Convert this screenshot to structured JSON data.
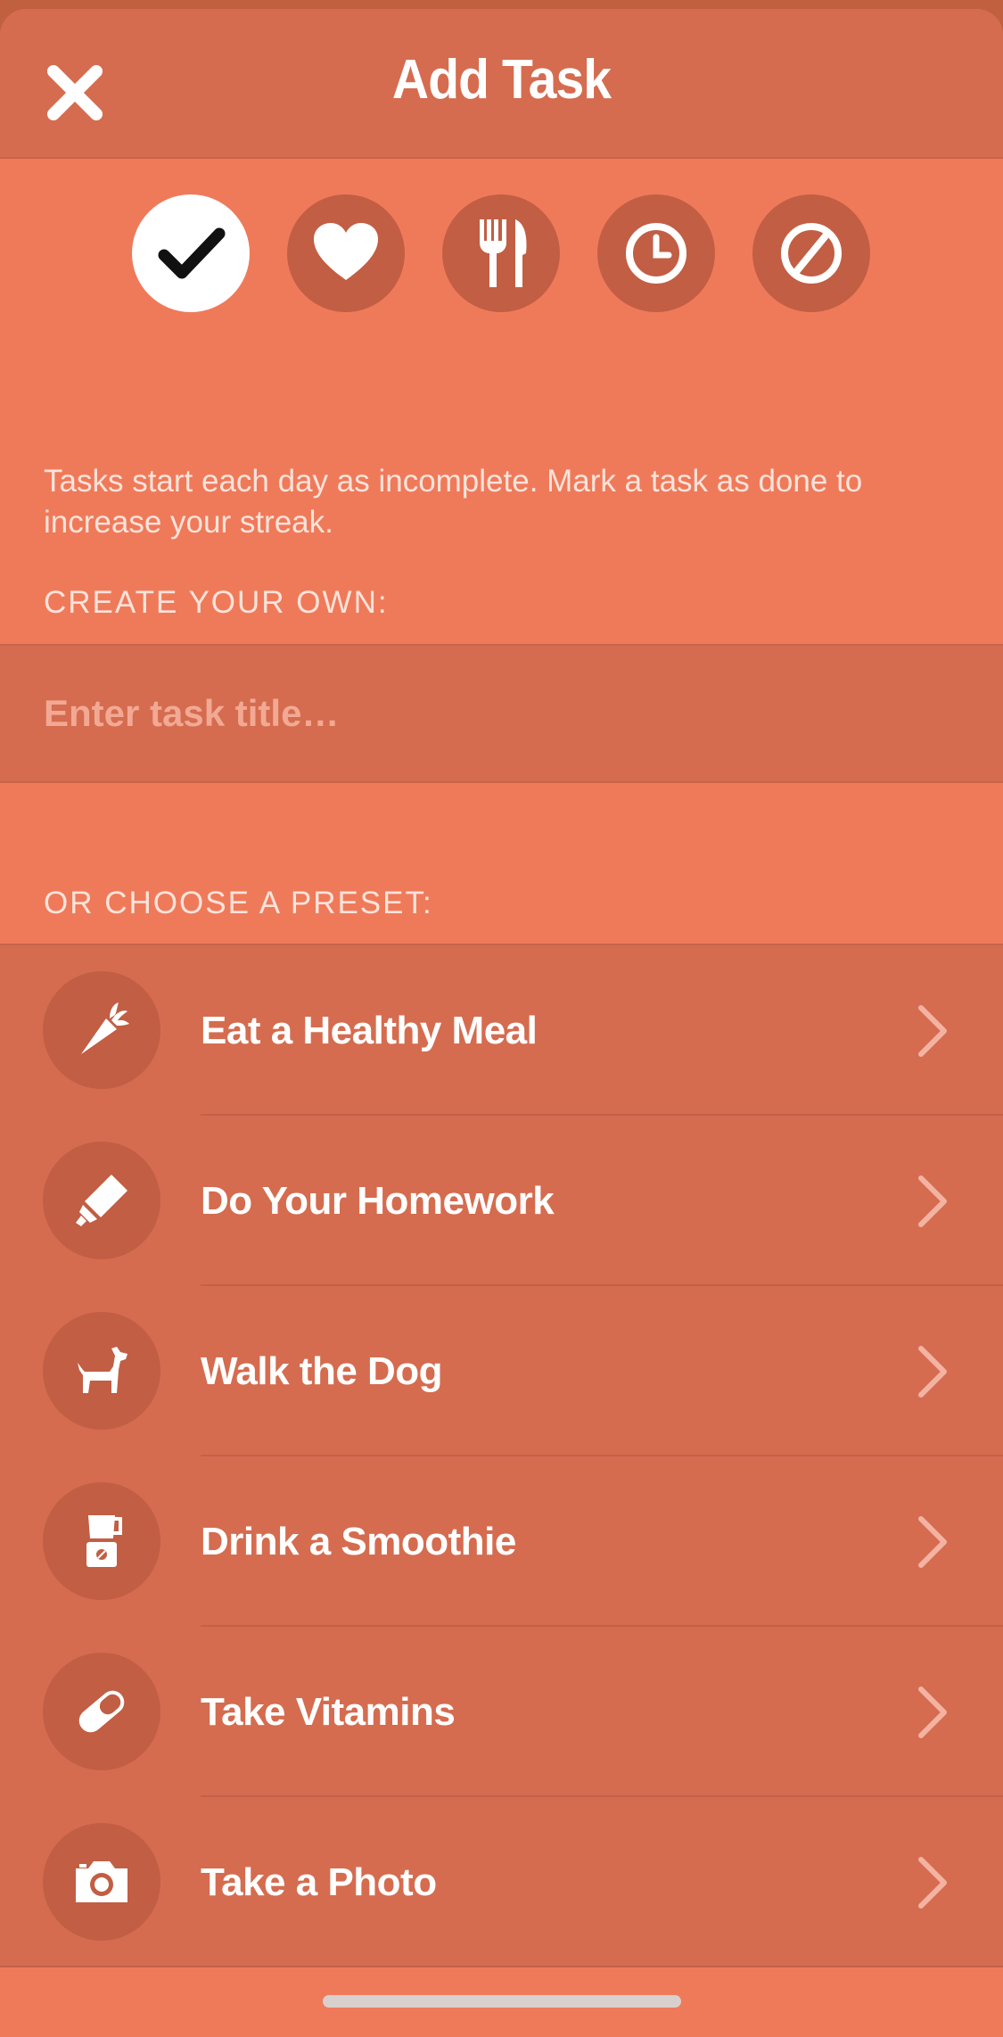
{
  "header": {
    "title": "Add Task",
    "close_icon": "close-icon"
  },
  "task_types": [
    {
      "icon": "checkmark-icon",
      "selected": true
    },
    {
      "icon": "heart-icon",
      "selected": false
    },
    {
      "icon": "fork-knife-icon",
      "selected": false
    },
    {
      "icon": "clock-icon",
      "selected": false
    },
    {
      "icon": "prohibited-icon",
      "selected": false
    }
  ],
  "help_text": "Tasks start each day as incomplete. Mark a task as done to increase your streak.",
  "create_section": {
    "label": "CREATE YOUR OWN:",
    "placeholder": "Enter task title…"
  },
  "preset_section": {
    "label": "OR CHOOSE A PRESET:",
    "items": [
      {
        "label": "Eat a Healthy Meal",
        "icon": "carrot-icon"
      },
      {
        "label": "Do Your Homework",
        "icon": "highlighter-icon"
      },
      {
        "label": "Walk the Dog",
        "icon": "dog-icon"
      },
      {
        "label": "Drink a Smoothie",
        "icon": "blender-icon"
      },
      {
        "label": "Take Vitamins",
        "icon": "pill-icon"
      },
      {
        "label": "Take a Photo",
        "icon": "camera-icon"
      }
    ]
  },
  "colors": {
    "background": "#ef7a5a",
    "navbar": "#d56c4f",
    "icon_circle": "#c25e44",
    "text": "#ffffff"
  }
}
